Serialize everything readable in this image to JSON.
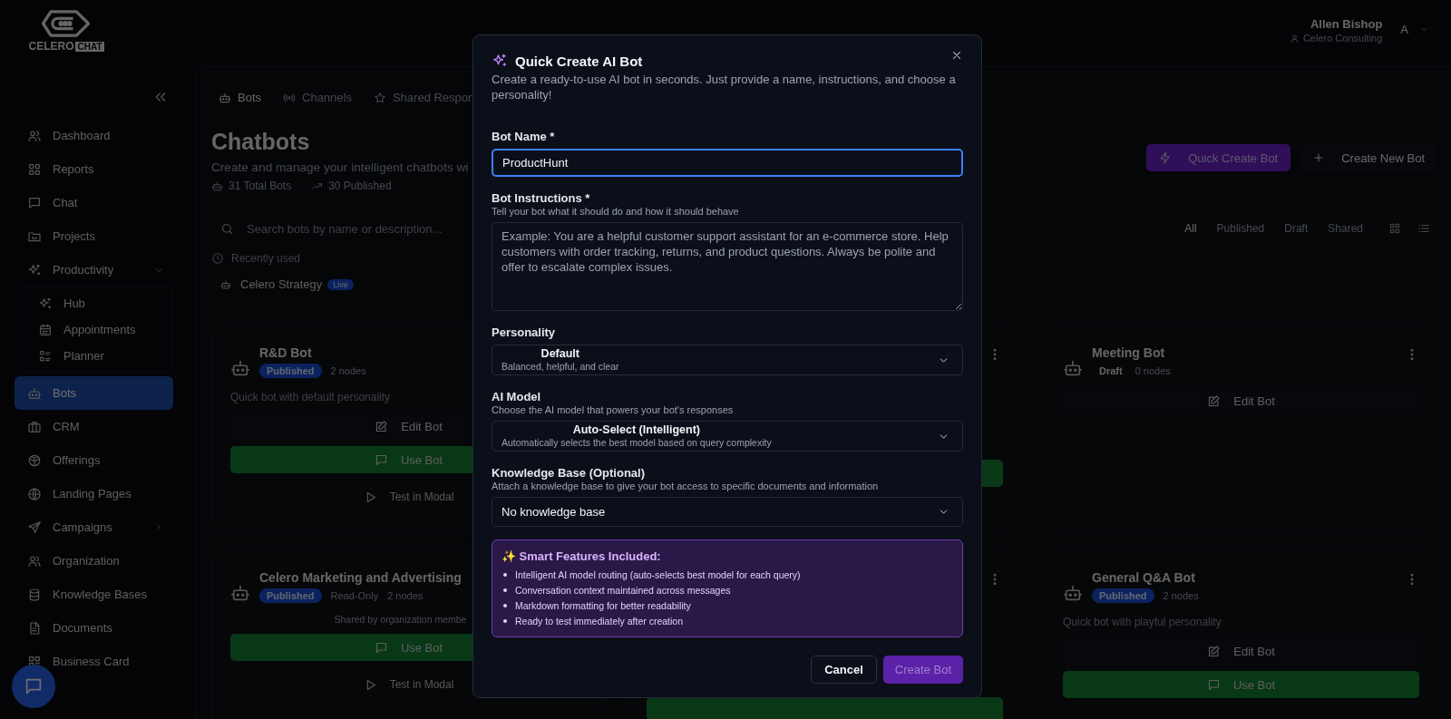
{
  "header": {
    "logo": {
      "word": "CELERO",
      "tag": "CHAT"
    },
    "user": {
      "name": "Allen Bishop",
      "org": "Celero Consulting",
      "avatar": "A"
    }
  },
  "sidebar": {
    "items": [
      {
        "label": "Dashboard",
        "kind": "link",
        "selected": false
      },
      {
        "label": "Reports",
        "kind": "link",
        "selected": false
      },
      {
        "label": "Chat",
        "kind": "link",
        "selected": false
      },
      {
        "label": "Projects",
        "kind": "link",
        "selected": false
      },
      {
        "label": "Productivity",
        "kind": "group",
        "selected": false,
        "expanded": true,
        "children": [
          {
            "label": "Hub",
            "selected": false
          },
          {
            "label": "Appointments",
            "selected": false
          },
          {
            "label": "Planner",
            "selected": false
          }
        ]
      },
      {
        "label": "Bots",
        "kind": "link",
        "selected": true
      },
      {
        "label": "CRM",
        "kind": "link",
        "selected": false
      },
      {
        "label": "Offerings",
        "kind": "link",
        "selected": false
      },
      {
        "label": "Landing Pages",
        "kind": "link",
        "selected": false
      },
      {
        "label": "Campaigns",
        "kind": "group",
        "selected": false,
        "expanded": false
      },
      {
        "label": "Organization",
        "kind": "link",
        "selected": false
      },
      {
        "label": "Knowledge Bases",
        "kind": "link",
        "selected": false
      },
      {
        "label": "Documents",
        "kind": "link",
        "selected": false
      },
      {
        "label": "Business Card",
        "kind": "link",
        "selected": false
      }
    ]
  },
  "tabs": [
    {
      "label": "Bots",
      "selected": true
    },
    {
      "label": "Channels",
      "selected": false
    },
    {
      "label": "Shared Respon",
      "selected": false
    }
  ],
  "page": {
    "title": "Chatbots",
    "subtitle": "Create and manage your intelligent chatbots wi",
    "stats": [
      "31 Total Bots",
      "30 Published"
    ]
  },
  "actions": [
    {
      "label": "Quick Create Bot",
      "kind": "primary"
    },
    {
      "label": "Create New Bot",
      "kind": "secondary"
    }
  ],
  "search": {
    "placeholder": "Search bots by name or description..."
  },
  "filters": [
    {
      "label": "All",
      "selected": true
    },
    {
      "label": "Published",
      "selected": false
    },
    {
      "label": "Draft",
      "selected": false
    },
    {
      "label": "Shared",
      "selected": false
    }
  ],
  "recent": {
    "label": "Recently used",
    "items": [
      {
        "name": "Celero Strategy",
        "badge": "Live"
      }
    ]
  },
  "cards": [
    {
      "kind": "bot",
      "title": "R&D Bot",
      "tags": [
        {
          "label": "Published",
          "kind": "published"
        },
        {
          "label": "2 nodes",
          "kind": "meta"
        }
      ],
      "description": "Quick bot with default personality",
      "buttons": [
        {
          "label": "Edit Bot",
          "kind": "edit"
        },
        {
          "label": "Use Bot",
          "kind": "use"
        },
        {
          "label": "Test in Modal",
          "kind": "test"
        }
      ]
    },
    {
      "kind": "covered",
      "buttons": [
        {
          "kind": "use"
        }
      ]
    },
    {
      "kind": "bot",
      "title": "Meeting Bot",
      "tags": [
        {
          "label": "Draft",
          "kind": "draft"
        },
        {
          "label": "0 nodes",
          "kind": "meta"
        }
      ],
      "buttons": [
        {
          "label": "Edit Bot",
          "kind": "edit"
        }
      ]
    },
    {
      "kind": "bot",
      "title": "Celero Marketing and Advertising",
      "tags": [
        {
          "label": "Published",
          "kind": "published"
        },
        {
          "label": "Read-Only",
          "kind": "plain"
        },
        {
          "label": "2 nodes",
          "kind": "meta"
        }
      ],
      "note": "Shared by organization membe",
      "buttons": [
        {
          "label": "Use Bot",
          "kind": "use"
        },
        {
          "label": "Test in Modal",
          "kind": "test"
        }
      ]
    },
    {
      "kind": "covered",
      "buttons": [
        {
          "kind": "use"
        }
      ]
    },
    {
      "kind": "bot",
      "title": "General Q&A Bot",
      "tags": [
        {
          "label": "Published",
          "kind": "published"
        },
        {
          "label": "2 nodes",
          "kind": "meta"
        }
      ],
      "description": "Quick bot with playful personality",
      "buttons": [
        {
          "label": "Edit Bot",
          "kind": "edit"
        },
        {
          "label": "Use Bot",
          "kind": "use"
        }
      ]
    }
  ],
  "modal": {
    "title": "Quick Create AI Bot",
    "description": "Create a ready-to-use AI bot in seconds. Just provide a name, instructions, and choose a personality!",
    "fields": [
      {
        "kind": "text",
        "label": "Bot Name *",
        "value": "ProductHunt",
        "focused": true
      },
      {
        "kind": "textarea",
        "label": "Bot Instructions *",
        "hint": "Tell your bot what it should do and how it should behave",
        "placeholder": "Example: You are a helpful customer support assistant for an e-commerce store. Help customers with order tracking, returns, and product questions. Always be polite and offer to escalate complex issues.",
        "focused": false
      },
      {
        "kind": "select",
        "label": "Personality",
        "value": "Default",
        "detail": "Balanced, helpful, and clear",
        "focused": false
      },
      {
        "kind": "select",
        "label": "AI Model",
        "hint": "Choose the AI model that powers your bot's responses",
        "value": "Auto-Select (Intelligent)",
        "detail": "Automatically selects the best model based on query complexity",
        "focused": false
      },
      {
        "kind": "select",
        "label": "Knowledge Base (Optional)",
        "hint": "Attach a knowledge base to give your bot access to specific documents and information",
        "value": "No knowledge base",
        "focused": false
      }
    ],
    "features": {
      "title": "✨ Smart Features Included:",
      "items": [
        "Intelligent AI model routing (auto-selects best model for each query)",
        "Conversation context maintained across messages",
        "Markdown formatting for better readability",
        "Ready to test immediately after creation"
      ]
    },
    "buttons": [
      {
        "label": "Cancel",
        "kind": "secondary",
        "disabled": false
      },
      {
        "label": "Create Bot",
        "kind": "primary",
        "disabled": true
      }
    ]
  }
}
